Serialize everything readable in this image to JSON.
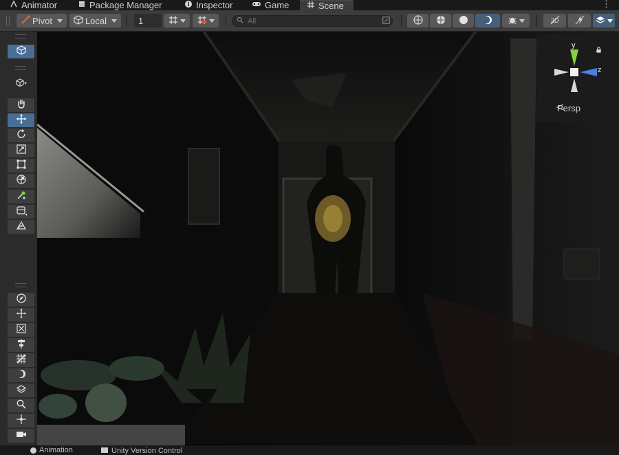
{
  "tabs": [
    {
      "label": "Animator",
      "icon": "animator-icon",
      "active": false
    },
    {
      "label": "Package Manager",
      "icon": "package-icon",
      "active": false
    },
    {
      "label": "Inspector",
      "icon": "info-icon",
      "active": false
    },
    {
      "label": "Game",
      "icon": "gamepad-icon",
      "active": false
    },
    {
      "label": "Scene",
      "icon": "scene-grid-icon",
      "active": true
    }
  ],
  "toolbar": {
    "pivot_label": "Pivot",
    "space_label": "Local",
    "grid_size_value": "1",
    "search_placeholder": "All"
  },
  "gizmo": {
    "projection_label": "Persp",
    "axis_y": "y",
    "axis_z": "z",
    "colors": {
      "y": "#8ad13f",
      "z": "#4a7fe0",
      "x": "#e0e0e0"
    }
  },
  "tool_groups": {
    "transform": [
      "view-hand-icon",
      "move-icon",
      "rotate-icon",
      "scale-icon",
      "rect-tool-icon",
      "transform-icon",
      "custom-editor-icon",
      "probe-volume-icon",
      "lod-icon"
    ],
    "overlay": [
      "compass-icon",
      "move-arrows-icon",
      "snap-icon",
      "align-icon",
      "grid-snap-icon",
      "lighting-icon",
      "layer-icon",
      "zoom-icon",
      "focus-icon",
      "camera-icon"
    ]
  },
  "bottom_tabs": [
    {
      "label": "Animation"
    },
    {
      "label": "Unity Version Control"
    }
  ],
  "colors": {
    "accent_selected": "#4a6d94",
    "toolbar_bg": "#3c3c3c",
    "panel_bg": "#2b2b2b"
  }
}
